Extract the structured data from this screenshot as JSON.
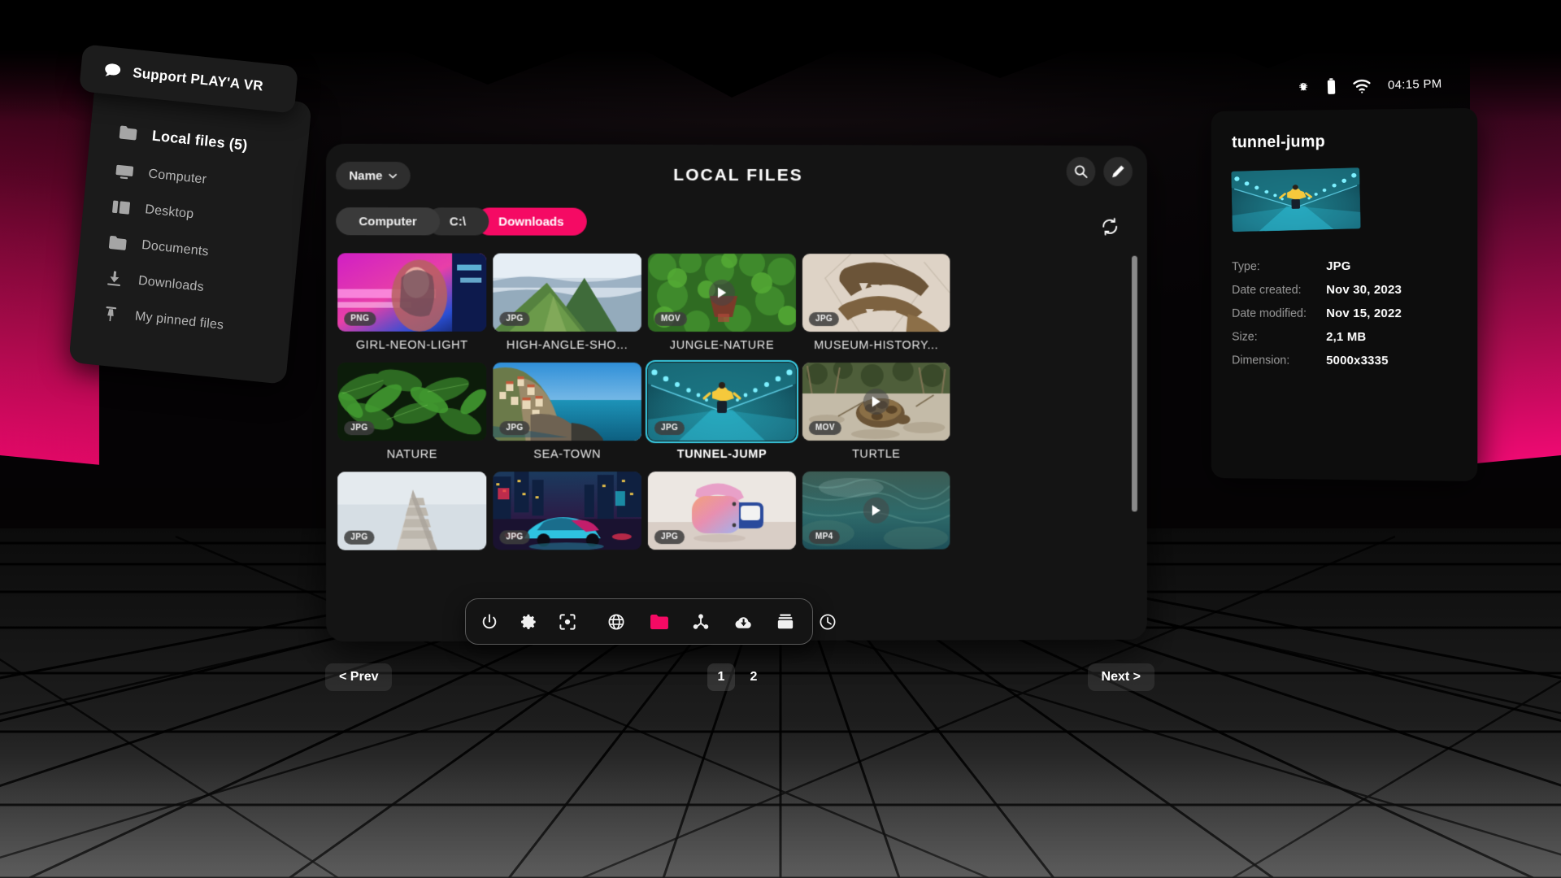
{
  "status_bar": {
    "icons": [
      "bug-icon",
      "battery-icon",
      "wifi-icon"
    ],
    "time": "04:15 PM"
  },
  "support": {
    "icon": "chat-bubble-icon",
    "label": "Support PLAY'A VR"
  },
  "sidebar": {
    "items": [
      {
        "icon": "folder-icon",
        "label": "Local files (5)",
        "active": true
      },
      {
        "icon": "monitor-icon",
        "label": "Computer",
        "active": false
      },
      {
        "icon": "desktop-icon",
        "label": "Desktop",
        "active": false
      },
      {
        "icon": "folder-icon",
        "label": "Documents",
        "active": false
      },
      {
        "icon": "download-icon",
        "label": "Downloads",
        "active": false
      },
      {
        "icon": "pin-icon",
        "label": "My pinned files",
        "active": false
      }
    ]
  },
  "main": {
    "title": "LOCAL FILES",
    "sort": {
      "label": "Name",
      "caret": "chevron-down-icon"
    },
    "actions": [
      {
        "icon": "search-icon",
        "name": "search-button"
      },
      {
        "icon": "pencil-icon",
        "name": "edit-button"
      }
    ],
    "refresh": {
      "icon": "refresh-icon"
    },
    "breadcrumbs": [
      {
        "label": "Computer",
        "active": false
      },
      {
        "label": "C:\\",
        "active": false
      },
      {
        "label": "Downloads",
        "active": true
      }
    ],
    "files": [
      {
        "name": "GIRL-NEON-LIGHT",
        "badge": "PNG",
        "art": "girl-neon",
        "video": false,
        "selected": false
      },
      {
        "name": "HIGH-ANGLE-SHO...",
        "badge": "JPG",
        "art": "mountains",
        "video": false,
        "selected": false
      },
      {
        "name": "JUNGLE-NATURE",
        "badge": "MOV",
        "art": "jungle",
        "video": true,
        "selected": false
      },
      {
        "name": "MUSEUM-HISTORY...",
        "badge": "JPG",
        "art": "museum",
        "video": false,
        "selected": false
      },
      {
        "name": "NATURE",
        "badge": "JPG",
        "art": "leaves",
        "video": false,
        "selected": false
      },
      {
        "name": "SEA-TOWN",
        "badge": "JPG",
        "art": "seatown",
        "video": false,
        "selected": false
      },
      {
        "name": "TUNNEL-JUMP",
        "badge": "JPG",
        "art": "tunnel",
        "video": false,
        "selected": true
      },
      {
        "name": "TURTLE",
        "badge": "MOV",
        "art": "turtle",
        "video": true,
        "selected": false
      },
      {
        "name": "",
        "badge": "JPG",
        "art": "building",
        "video": false,
        "selected": false
      },
      {
        "name": "",
        "badge": "JPG",
        "art": "cybercar",
        "video": false,
        "selected": false
      },
      {
        "name": "",
        "badge": "JPG",
        "art": "headset",
        "video": false,
        "selected": false
      },
      {
        "name": "",
        "badge": "MP4",
        "art": "underwater",
        "video": true,
        "selected": false
      }
    ]
  },
  "pagination": {
    "prev": "< Prev",
    "next": "Next >",
    "pages": [
      {
        "label": "1",
        "active": true
      },
      {
        "label": "2",
        "active": false
      }
    ]
  },
  "dock": {
    "group1": [
      {
        "icon": "power-icon",
        "active": false
      },
      {
        "icon": "gear-icon",
        "active": false
      },
      {
        "icon": "screenshot-icon",
        "active": false
      }
    ],
    "group2": [
      {
        "icon": "globe-icon",
        "active": false
      },
      {
        "icon": "folder-icon",
        "active": true
      },
      {
        "icon": "share-network-icon",
        "active": false
      },
      {
        "icon": "cloud-download-icon",
        "active": false
      },
      {
        "icon": "archive-box-icon",
        "active": false
      },
      {
        "icon": "clock-icon",
        "active": false
      }
    ]
  },
  "detail": {
    "title": "tunnel-jump",
    "thumb_art": "tunnel",
    "meta": [
      {
        "key": "Type:",
        "value": "JPG"
      },
      {
        "key": "Date created:",
        "value": "Nov 30, 2023"
      },
      {
        "key": "Date modified:",
        "value": "Nov 15, 2022"
      },
      {
        "key": "Size:",
        "value": "2,1 MB"
      },
      {
        "key": "Dimension:",
        "value": "5000x3335"
      }
    ]
  },
  "colors": {
    "accent_pink": "#F50A64",
    "panel_bg": "#141414",
    "sidebar_bg": "#1b1b1b",
    "selection": "#39d0e8"
  }
}
